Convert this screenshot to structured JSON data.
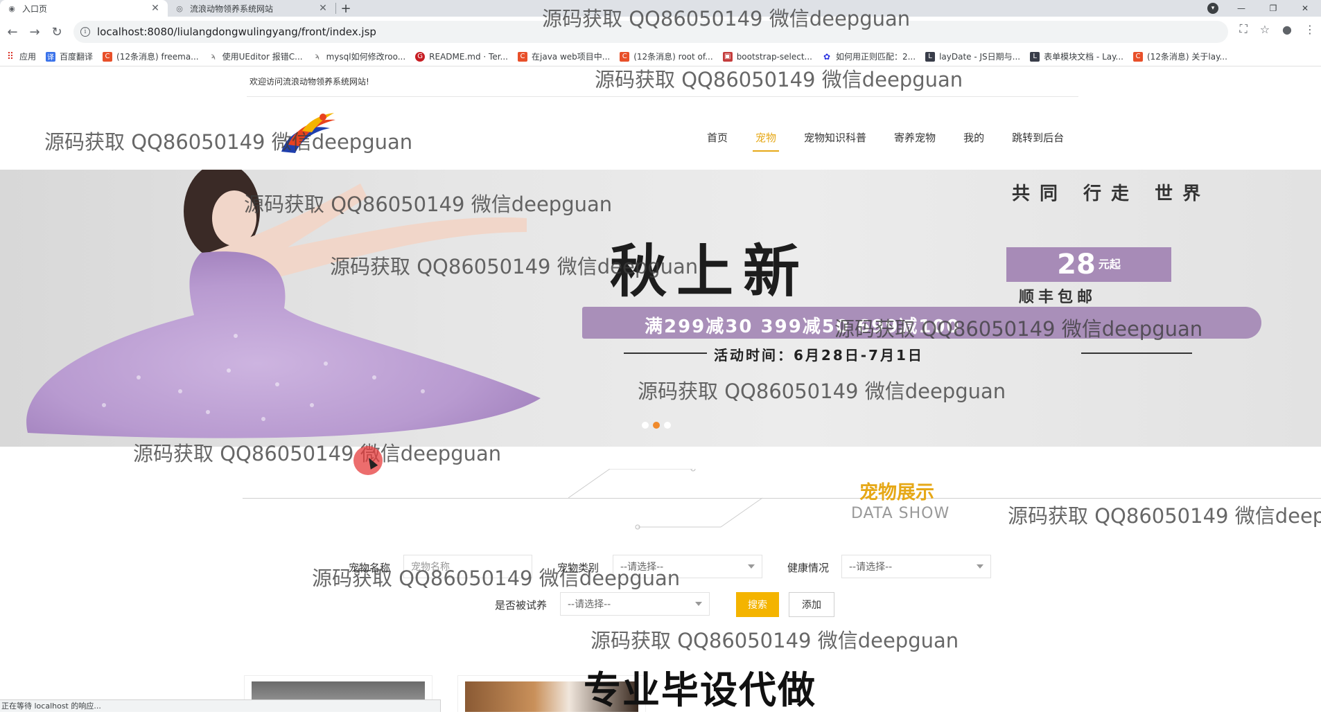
{
  "browser": {
    "tabs": [
      {
        "title": "入口页",
        "active": true
      },
      {
        "title": "流浪动物领养系统网站",
        "active": false
      }
    ],
    "url": "localhost:8080/liulangdongwulingyang/front/index.jsp",
    "bookmarks": [
      {
        "label": "应用",
        "icon": "apps-icon",
        "color": "#d93025"
      },
      {
        "label": "百度翻译",
        "icon": "translate-icon",
        "color": "#3b73ea"
      },
      {
        "label": "(12条消息) freema...",
        "icon": "csdn-icon",
        "color": "#e8502a"
      },
      {
        "label": "使用UEditor 报错C...",
        "icon": "bookmark-icon",
        "color": "#555555"
      },
      {
        "label": "mysql如何修改roo...",
        "icon": "bookmark-icon",
        "color": "#555555"
      },
      {
        "label": "README.md · Ter...",
        "icon": "gitee-icon",
        "color": "#c71d23"
      },
      {
        "label": "在java web项目中...",
        "icon": "csdn-icon",
        "color": "#e8502a"
      },
      {
        "label": "(12条消息) root of...",
        "icon": "csdn-icon",
        "color": "#e8502a"
      },
      {
        "label": "bootstrap-select...",
        "icon": "bookmark-icon",
        "color": "#c43c3c"
      },
      {
        "label": "如何用正则匹配：2...",
        "icon": "baidu-icon",
        "color": "#2932e1"
      },
      {
        "label": "layDate - JS日期与...",
        "icon": "layui-icon",
        "color": "#393d49"
      },
      {
        "label": "表单模块文档 - Lay...",
        "icon": "layui-icon",
        "color": "#393d49"
      },
      {
        "label": "(12条消息) 关于lay...",
        "icon": "csdn-icon",
        "color": "#e8502a"
      }
    ],
    "status": "正在等待 localhost 的响应..."
  },
  "site": {
    "welcome": "欢迎访问流浪动物领养系统网站!",
    "nav": [
      {
        "label": "首页",
        "active": false
      },
      {
        "label": "宠物",
        "active": true
      },
      {
        "label": "宠物知识科普",
        "active": false
      },
      {
        "label": "寄养宠物",
        "active": false
      },
      {
        "label": "我的",
        "active": false
      },
      {
        "label": "跳转到后台",
        "active": false
      }
    ],
    "banner": {
      "headline": "秋上新",
      "price": "28",
      "price_unit": "元起",
      "shipping": "顺丰包邮",
      "promo": "满299减30  399减50  699减100",
      "date": "活动时间：6月28日-7月1日",
      "slide_count": 3,
      "active_slide": 2
    },
    "section": {
      "title_cn": "宠物展示",
      "title_en": "DATA SHOW"
    },
    "filters": {
      "name_label": "宠物名称",
      "name_placeholder": "宠物名称",
      "type_label": "宠物类别",
      "type_value": "--请选择--",
      "health_label": "健康情况",
      "health_value": "--请选择--",
      "trial_label": "是否被试养",
      "trial_value": "--请选择--",
      "search_button": "搜索",
      "add_button": "添加"
    }
  },
  "overlays": {
    "watermark": "源码获取 QQ86050149 微信deepguan",
    "promo": "专业毕设代做"
  },
  "colors": {
    "accent": "#e6a817",
    "banner_purple": "#a78bb7",
    "carousel_active": "#f08a2c"
  }
}
